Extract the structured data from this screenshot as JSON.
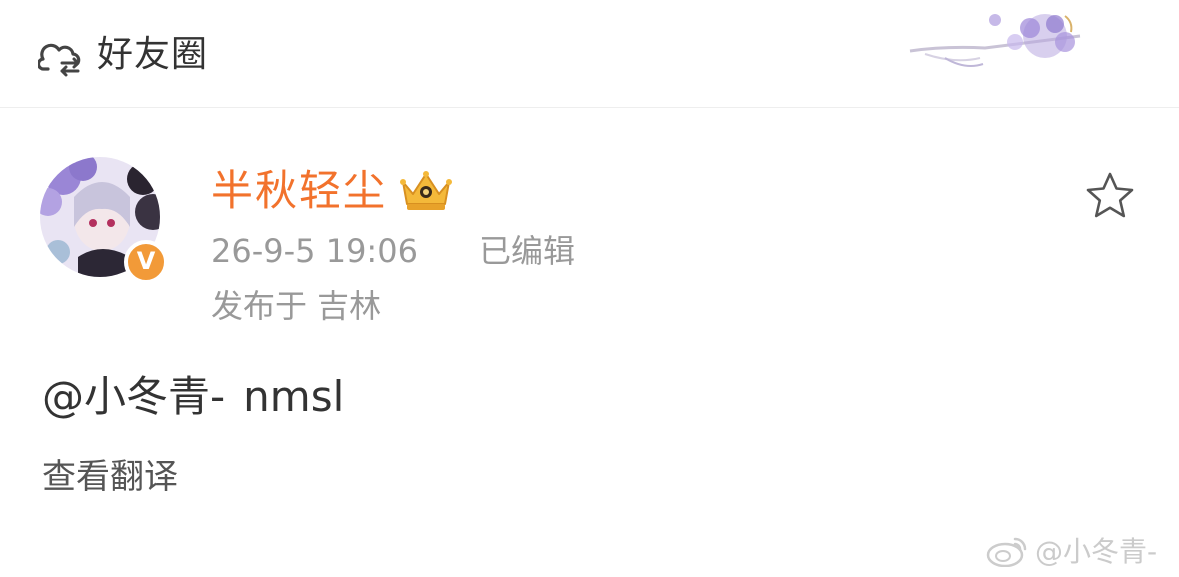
{
  "header": {
    "title": "好友圈",
    "icon": "friends-cloud-icon"
  },
  "post": {
    "username": "半秋轻尘",
    "username_color": "#f2722c",
    "member_badge": "crown-icon",
    "verified_badge": "V",
    "timestamp": "26-9-5 19:06",
    "edited_label": "已编辑",
    "location": "发布于 吉林",
    "mention": "@小冬青-",
    "text": "nmsl",
    "translate_label": "查看翻译",
    "favorite_icon": "star-icon"
  },
  "watermark": {
    "text": "@小冬青-",
    "icon": "weibo-icon"
  },
  "colors": {
    "accent": "#f2722c",
    "badge": "#f29a38",
    "muted": "#999999"
  }
}
